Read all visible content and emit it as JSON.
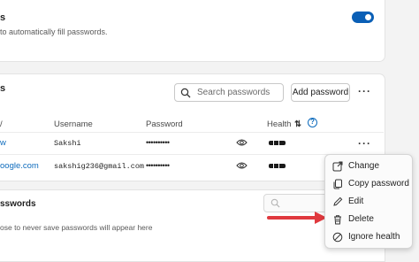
{
  "autofill": {
    "title_fragment": "s",
    "description": "to automatically fill passwords.",
    "toggle_on": true
  },
  "saved": {
    "title_fragment": "s",
    "search_placeholder": "Search passwords",
    "add_button": "Add password",
    "more_label": "···",
    "columns": {
      "site": "/",
      "username": "Username",
      "password": "Password",
      "health": "Health",
      "sort_icon": "⇅",
      "help_icon": "?"
    },
    "rows": [
      {
        "site": "w",
        "username": "Sakshi",
        "password": "••••••••••",
        "more": "···"
      },
      {
        "site": "oogle.com",
        "username": "sakshig236@gmail.com",
        "password": "••••••••••"
      }
    ]
  },
  "never_saved": {
    "title_fragment": "sswords",
    "description": "ose to never save passwords will appear here"
  },
  "context_menu": {
    "items": [
      {
        "label": "Change",
        "icon": "external-link-icon"
      },
      {
        "label": "Copy password",
        "icon": "copy-icon"
      },
      {
        "label": "Edit",
        "icon": "pencil-icon"
      },
      {
        "label": "Delete",
        "icon": "trash-icon"
      },
      {
        "label": "Ignore health",
        "icon": "prohibited-icon"
      }
    ]
  },
  "colors": {
    "accent": "#0a5fb6",
    "link": "#0f6cbd",
    "arrow": "#e0393e"
  }
}
